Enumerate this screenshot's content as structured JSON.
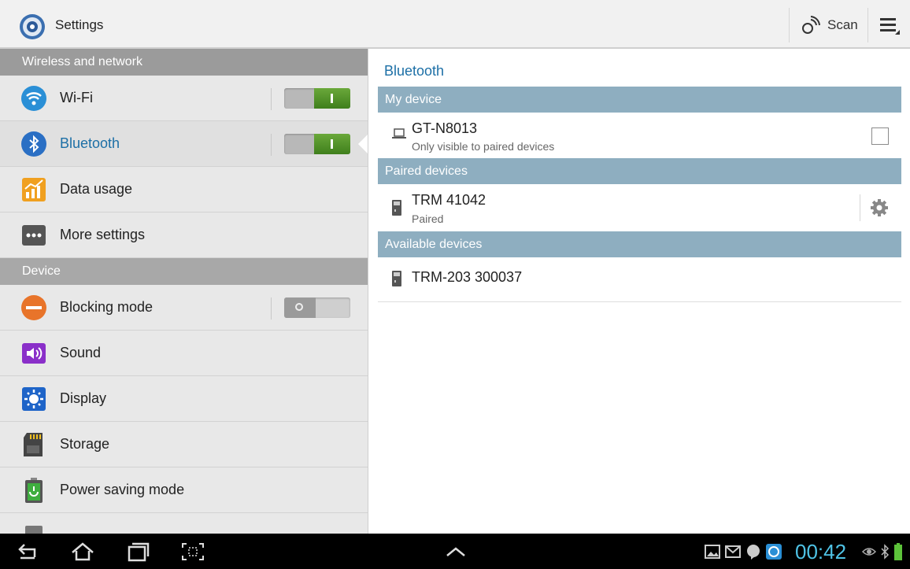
{
  "app": {
    "title": "Settings"
  },
  "actionbar": {
    "scan_label": "Scan"
  },
  "left": {
    "sections": [
      {
        "header": "Wireless and network"
      },
      {
        "header": "Device"
      }
    ],
    "items": {
      "wifi": {
        "label": "Wi-Fi",
        "toggle": "on"
      },
      "bluetooth": {
        "label": "Bluetooth",
        "toggle": "on"
      },
      "data_usage": {
        "label": "Data usage"
      },
      "more_settings": {
        "label": "More settings"
      },
      "blocking_mode": {
        "label": "Blocking mode",
        "toggle": "off"
      },
      "sound": {
        "label": "Sound"
      },
      "display": {
        "label": "Display"
      },
      "storage": {
        "label": "Storage"
      },
      "power_saving": {
        "label": "Power saving mode"
      }
    }
  },
  "right": {
    "title": "Bluetooth",
    "my_device": {
      "header": "My device",
      "name": "GT-N8013",
      "subtitle": "Only visible to paired devices"
    },
    "paired": {
      "header": "Paired devices",
      "name": "TRM 41042",
      "status": "Paired"
    },
    "available": {
      "header": "Available devices",
      "name": "TRM-203 300037"
    }
  },
  "statusbar": {
    "time": "00:42"
  },
  "colors": {
    "accent": "#1c6fa6",
    "section_header": "#8eaec0",
    "toggle_on": "#4f8f26",
    "clock": "#4fc3e6"
  }
}
